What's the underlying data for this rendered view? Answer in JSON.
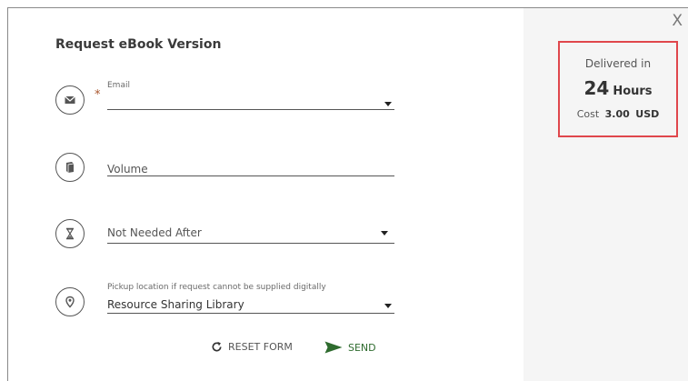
{
  "dialog": {
    "title": "Request eBook Version",
    "close_label": "X"
  },
  "form": {
    "email": {
      "label": "Email",
      "required_mark": "*",
      "value": "",
      "icon": "envelope-icon"
    },
    "volume": {
      "placeholder": "Volume",
      "icon": "book-icon"
    },
    "not_needed_after": {
      "placeholder": "Not Needed After",
      "icon": "hourglass-icon"
    },
    "pickup": {
      "label": "Pickup location if request cannot be supplied digitally",
      "value": "Resource Sharing Library",
      "icon": "location-pin-icon"
    }
  },
  "actions": {
    "reset_label": "RESET FORM",
    "send_label": "SEND"
  },
  "delivery": {
    "label": "Delivered in",
    "hours": "24",
    "hours_unit": "Hours",
    "cost_label": "Cost",
    "cost_amount": "3.00",
    "currency": "USD"
  },
  "colors": {
    "highlight_border": "#e0474c",
    "send_green": "#2e6b2e",
    "panel_bg": "#f5f5f5"
  }
}
